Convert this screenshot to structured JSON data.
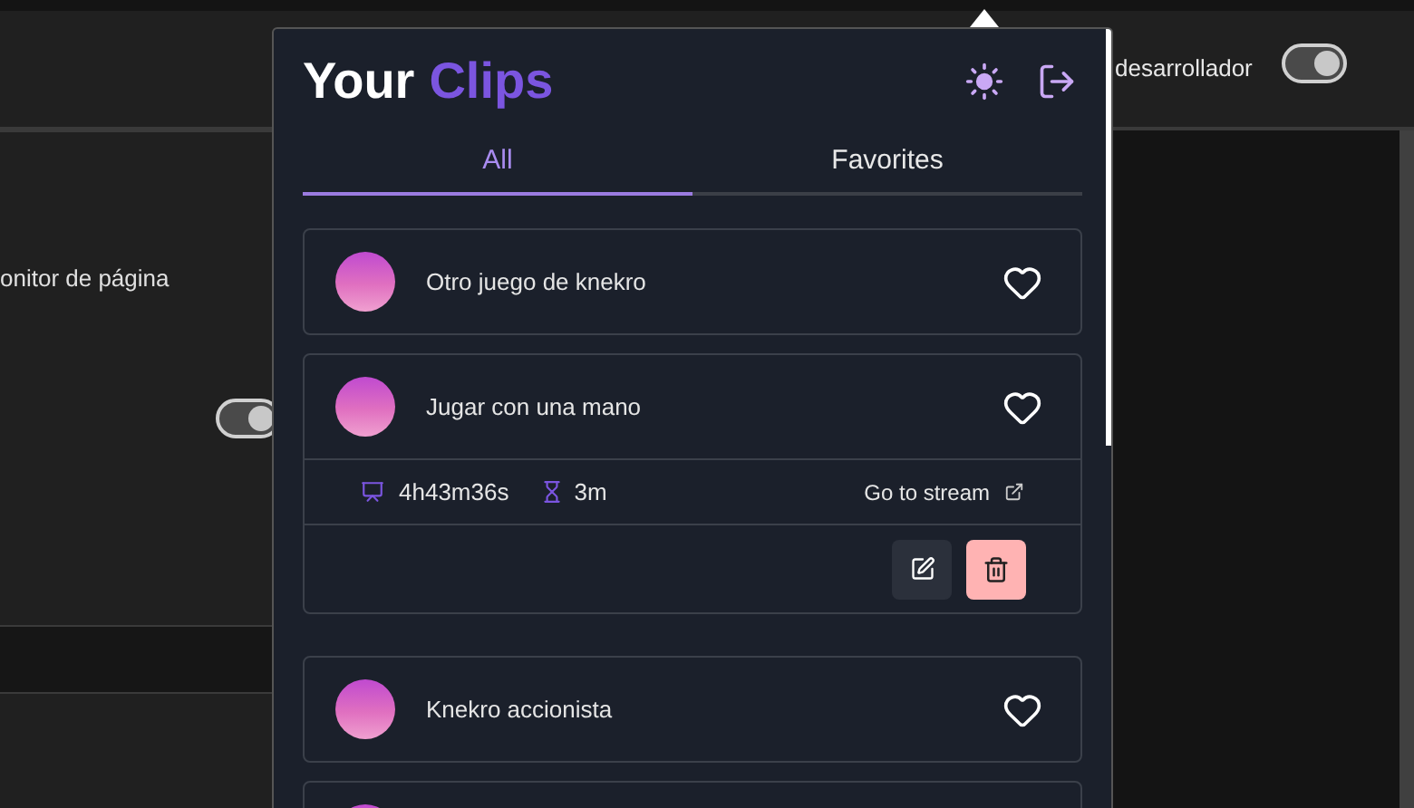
{
  "background": {
    "developer_setting": {
      "label": "desarrollador",
      "on": true
    },
    "page_monitor_setting": {
      "label": "onitor de página",
      "on": true
    }
  },
  "popup": {
    "title": "Your",
    "title_accent": "Clips",
    "tabs": [
      {
        "label": "All",
        "selected": true
      },
      {
        "label": "Favorites",
        "selected": false
      }
    ],
    "clips": [
      {
        "title": "Otro juego de knekro",
        "favorite": false,
        "expanded": false
      },
      {
        "title": "Jugar con una mano",
        "favorite": false,
        "expanded": true,
        "stream_time": "4h43m36s",
        "duration": "3m",
        "link": "Go to stream"
      },
      {
        "title": "Knekro accionista",
        "favorite": false,
        "expanded": false
      }
    ]
  }
}
